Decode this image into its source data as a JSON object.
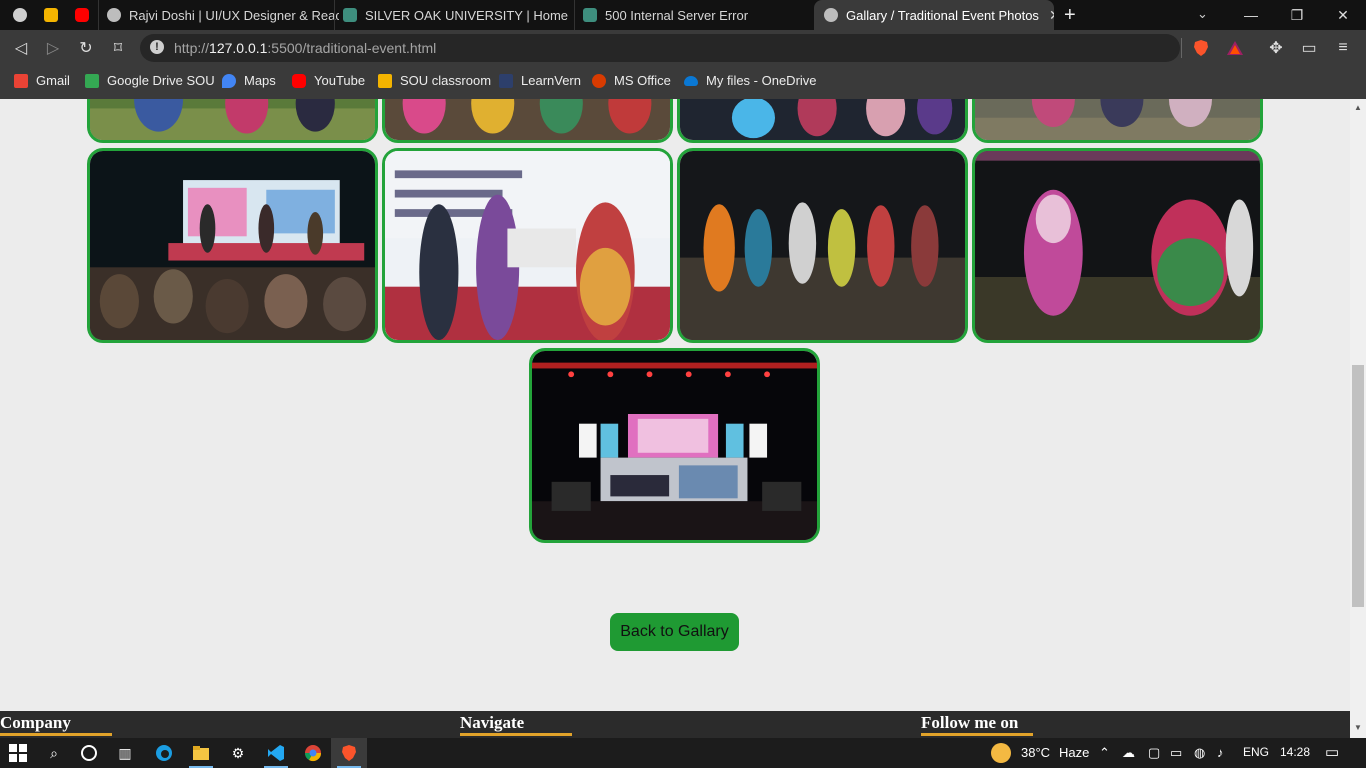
{
  "tabs": [
    {
      "title": "Rajvi Doshi | UI/UX Designer & React D",
      "icon": "globe-icon"
    },
    {
      "title": "SILVER OAK UNIVERSITY | Home",
      "icon": "university-logo-icon"
    },
    {
      "title": "500 Internal Server Error",
      "icon": "university-logo-icon"
    },
    {
      "title": "Gallary / Traditional Event Photos",
      "icon": "globe-icon",
      "active": true
    }
  ],
  "address_bar": {
    "url_prefix": "http://",
    "url_host": "127.0.0.1",
    "url_rest": ":5500/traditional-event.html"
  },
  "bookmarks": [
    {
      "label": "Gmail",
      "icon": "gmail-icon",
      "color": "#ea4335"
    },
    {
      "label": "Google Drive SOU",
      "icon": "google-drive-icon",
      "color": "#34a853"
    },
    {
      "label": "Maps",
      "icon": "maps-icon",
      "color": "#4285f4"
    },
    {
      "label": "YouTube",
      "icon": "youtube-icon",
      "color": "#ff0000"
    },
    {
      "label": "SOU classroom",
      "icon": "classroom-icon",
      "color": "#f4b400"
    },
    {
      "label": "LearnVern",
      "icon": "learnvern-icon",
      "color": "#2d3f6b"
    },
    {
      "label": "MS Office",
      "icon": "office-icon",
      "color": "#d83b01"
    },
    {
      "label": "My files - OneDrive",
      "icon": "onedrive-icon",
      "color": "#0a78d4"
    }
  ],
  "page": {
    "back_button": "Back to Gallary",
    "photo_border_color": "#23a33a",
    "photos": [
      {
        "name": "garba-dancers-photo"
      },
      {
        "name": "garba-circle-photo"
      },
      {
        "name": "glowing-ball-dance-photo"
      },
      {
        "name": "crowd-dance-photo"
      },
      {
        "name": "stage-performance-photo"
      },
      {
        "name": "prize-ceremony-photo"
      },
      {
        "name": "night-garba-photo"
      },
      {
        "name": "dandiya-couple-photo"
      },
      {
        "name": "concert-stage-prizes-photo"
      }
    ]
  },
  "footer": {
    "company": "Company",
    "navigate": "Navigate",
    "follow": "Follow me on",
    "accent_color": "#e2a32a"
  },
  "taskbar": {
    "weather_temp": "38°C",
    "weather_text": "Haze",
    "language": "ENG",
    "time": "14:28"
  }
}
